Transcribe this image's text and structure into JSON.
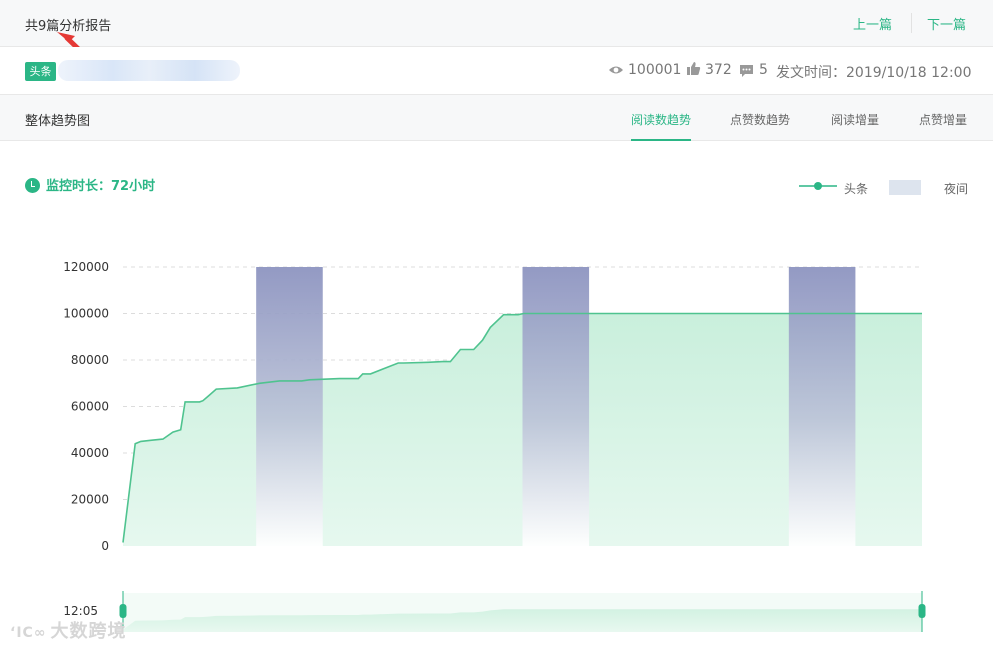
{
  "header": {
    "count_text": "共9篇分析报告",
    "prev_label": "上一篇",
    "next_label": "下一篇"
  },
  "article": {
    "source_tag": "头条",
    "views": "100001",
    "likes": "372",
    "comments": "5",
    "publish_time": "发文时间：2019/10/18 12:00"
  },
  "section": {
    "title": "整体趋势图",
    "tabs": [
      "阅读数趋势",
      "点赞数趋势",
      "阅读增量",
      "点赞增量"
    ],
    "active_tab": 0
  },
  "monitor": {
    "label": "监控时长：72小时"
  },
  "legend": {
    "series_label": "头条",
    "night_label": "夜间"
  },
  "colors": {
    "accent": "#2bb686",
    "area_fill": "#d4f3e4",
    "line": "#4fc38f",
    "night_top": "#8b92bf",
    "night_fill": "#dde4ee"
  },
  "chart_data": {
    "type": "area",
    "xlabel": "",
    "ylabel": "",
    "ylim": [
      0,
      120000
    ],
    "y_ticks": [
      0,
      20000,
      40000,
      60000,
      80000,
      100000,
      120000
    ],
    "x_range_hours": [
      0,
      72
    ],
    "series": [
      {
        "name": "头条",
        "x": [
          0,
          1.1,
          1.6,
          2.6,
          3.6,
          4.5,
          5.2,
          5.6,
          6.9,
          7.2,
          7.7,
          8.4,
          10.3,
          12.3,
          14.1,
          16.1,
          16.8,
          19.5,
          21.2,
          21.6,
          22.3,
          24.8,
          25.3,
          27.5,
          28.8,
          29.5,
          30.4,
          31.6,
          32.4,
          33.1,
          34.3,
          35.6,
          36.1,
          48,
          72
        ],
        "y": [
          1500,
          44000,
          45000,
          45500,
          46000,
          49000,
          50000,
          62000,
          62000,
          62500,
          64500,
          67500,
          68000,
          70000,
          71000,
          71000,
          71500,
          72000,
          72000,
          74000,
          74000,
          78700,
          78700,
          79000,
          79300,
          79300,
          84500,
          84500,
          88500,
          94000,
          99500,
          99500,
          100000,
          100000,
          100000
        ]
      }
    ],
    "night_bands_hours": [
      [
        12,
        18
      ],
      [
        36,
        42
      ],
      [
        60,
        66
      ]
    ],
    "timeline_label": "12:05"
  },
  "watermark": {
    "text": "大数跨境"
  }
}
